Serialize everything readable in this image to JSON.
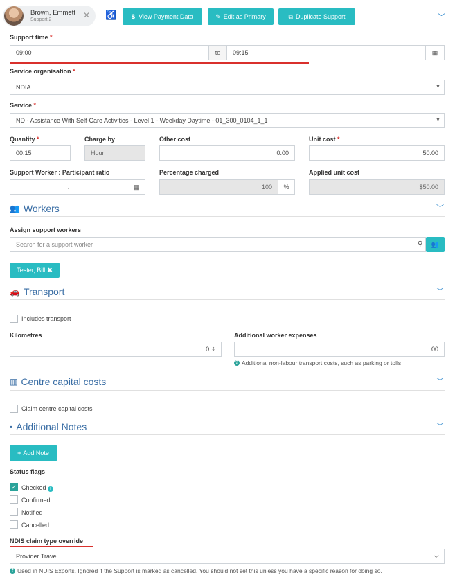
{
  "header": {
    "person_name": "Brown, Emmett",
    "person_sub": "Support 2",
    "view_payment": "View Payment Data",
    "edit_primary": "Edit as Primary",
    "duplicate": "Duplicate Support"
  },
  "support_time": {
    "label": "Support time",
    "start": "09:00",
    "to": "to",
    "end": "09:15"
  },
  "service_org": {
    "label": "Service organisation",
    "value": "NDIA"
  },
  "service": {
    "label": "Service",
    "value": "ND - Assistance With Self-Care Activities - Level 1 - Weekday Daytime - 01_300_0104_1_1"
  },
  "row1": {
    "quantity_label": "Quantity",
    "quantity": "00:15",
    "charge_by_label": "Charge by",
    "charge_by": "Hour",
    "other_cost_label": "Other cost",
    "other_cost": "0.00",
    "unit_cost_label": "Unit cost",
    "unit_cost": "50.00"
  },
  "row2": {
    "ratio_label": "Support Worker : Participant ratio",
    "ratio_sep": ":",
    "pct_label": "Percentage charged",
    "pct": "100",
    "pct_unit": "%",
    "applied_label": "Applied unit cost",
    "applied": "$50.00"
  },
  "workers": {
    "title": "Workers",
    "assign_label": "Assign support workers",
    "search_placeholder": "Search for a support worker",
    "tag": "Tester, Bill"
  },
  "transport": {
    "title": "Transport",
    "includes": "Includes transport",
    "km_label": "Kilometres",
    "km": "0",
    "expenses_label": "Additional worker expenses",
    "expenses": ".00",
    "help": "Additional non-labour transport costs, such as parking or tolls"
  },
  "centre": {
    "title": "Centre capital costs",
    "claim": "Claim centre capital costs"
  },
  "notes": {
    "title": "Additional Notes",
    "add_note": "Add Note",
    "status_label": "Status flags",
    "flags": [
      "Checked",
      "Confirmed",
      "Notified",
      "Cancelled"
    ]
  },
  "ndis": {
    "label": "NDIS claim type override",
    "value": "Provider Travel",
    "help": "Used in NDIS Exports. Ignored if the Support is marked as cancelled. You should not set this unless you have a specific reason for doing so."
  },
  "colors": {
    "accent": "#29bcc2",
    "section": "#3a6ea5",
    "required": "#d9302c",
    "checked": "#2aa39a"
  }
}
